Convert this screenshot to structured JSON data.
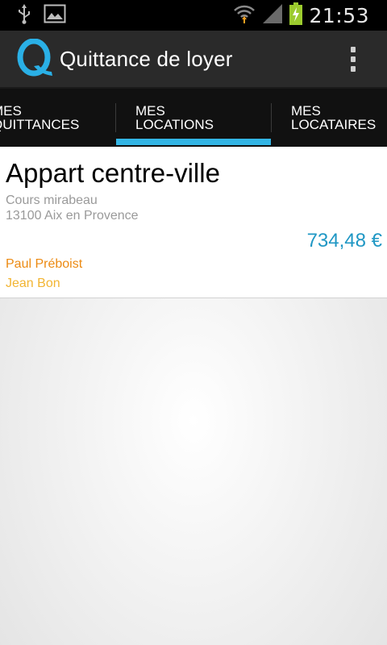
{
  "status_bar": {
    "time": "21:53",
    "icons": [
      "usb-icon",
      "image-icon",
      "wifi-icon",
      "signal-icon",
      "battery-charging-icon"
    ]
  },
  "action_bar": {
    "logo_letter": "Q",
    "title": "Quittance de loyer",
    "menu_icon": "overflow-menu-icon"
  },
  "tabs": [
    {
      "line1": "MES",
      "line2": "QUITTANCES"
    },
    {
      "line1": "MES",
      "line2": "LOCATIONS"
    },
    {
      "line1": "MES",
      "line2": "LOCATAIRES"
    }
  ],
  "selected_tab": 1,
  "rental": {
    "title": "Appart centre-ville",
    "address_line1": "Cours mirabeau",
    "address_line2": "13100 Aix en Provence",
    "amount": "734,48 €",
    "tenants": [
      "Paul Préboist",
      "Jean Bon"
    ]
  },
  "colors": {
    "accent": "#33b5e5",
    "amount": "#1f97c4",
    "tenant_primary": "#ec8a12",
    "tenant_secondary": "#f2b533"
  }
}
